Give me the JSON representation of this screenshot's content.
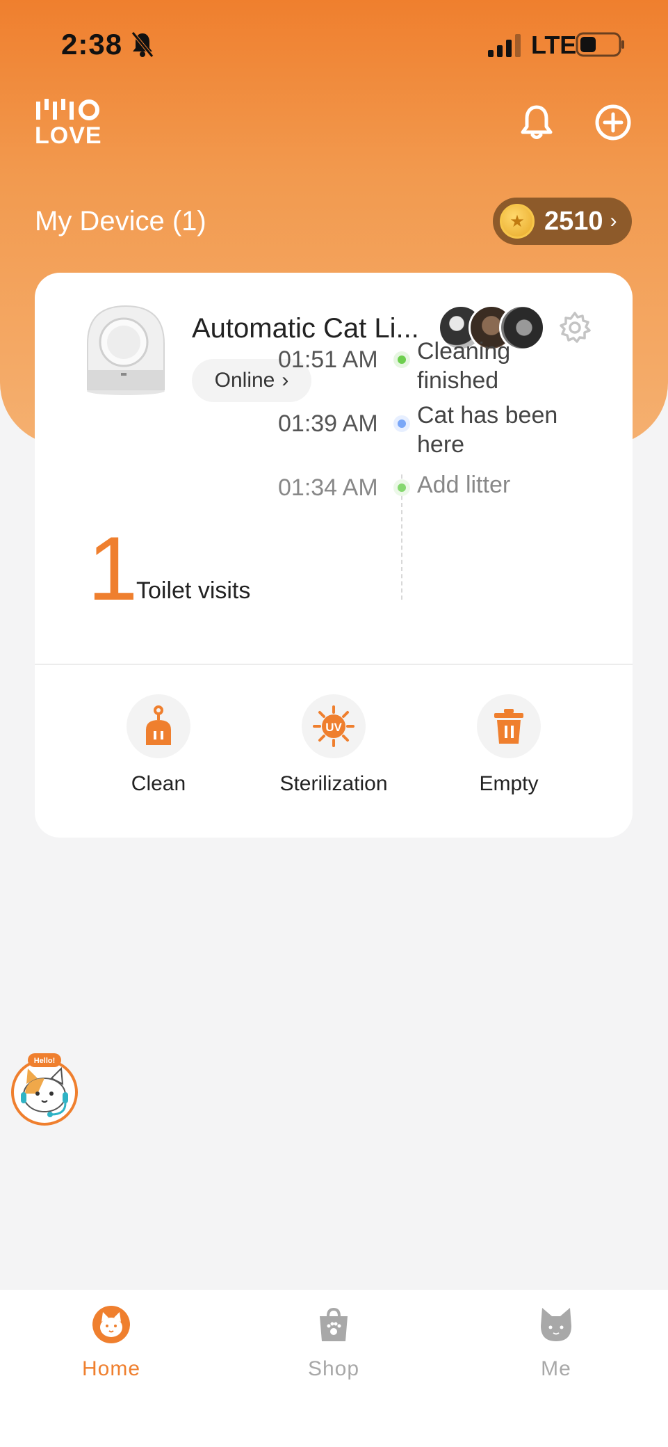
{
  "status_bar": {
    "time": "2:38",
    "network": "LTE"
  },
  "header": {
    "logo_text": "LOVE",
    "my_device_label": "My Device (1)",
    "coins": "2510",
    "colors": {
      "brand_orange": "#ef7f2e",
      "coin_pill": "#8d5a2a"
    }
  },
  "device_card": {
    "name": "Automatic Cat Li...",
    "status": "Online",
    "visits_count": "1",
    "visits_label": "Toilet visits",
    "timeline": [
      {
        "time": "01:51 AM",
        "event": "Cleaning finished",
        "dot_color": "#6dcf4e"
      },
      {
        "time": "01:39 AM",
        "event": "Cat has been here",
        "dot_color": "#7aa7f7"
      },
      {
        "time": "01:34 AM",
        "event": "Add litter",
        "dot_color": "#86d870"
      }
    ],
    "actions": [
      {
        "label": "Clean",
        "icon": "clean-icon"
      },
      {
        "label": "Sterilization",
        "icon": "uv-icon",
        "icon_text": "UV"
      },
      {
        "label": "Empty",
        "icon": "trash-icon"
      }
    ]
  },
  "helper": {
    "badge": "Hello!"
  },
  "tabbar": {
    "tabs": [
      {
        "label": "Home",
        "active": true,
        "icon": "home-cat-icon"
      },
      {
        "label": "Shop",
        "active": false,
        "icon": "shop-bag-icon"
      },
      {
        "label": "Me",
        "active": false,
        "icon": "cat-face-icon"
      }
    ],
    "active_color": "#ef7f2e",
    "inactive_color": "#a8a8a8"
  }
}
